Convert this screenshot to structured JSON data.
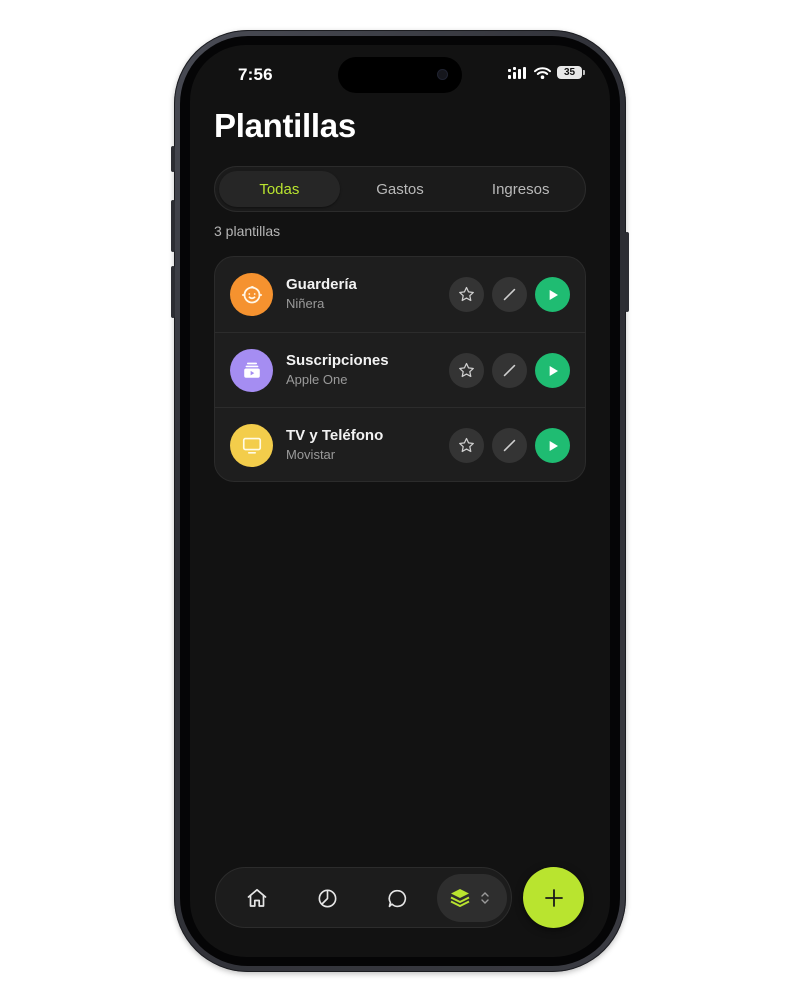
{
  "status_bar": {
    "time": "7:56",
    "battery": "35"
  },
  "page": {
    "title": "Plantillas",
    "count_label": "3 plantillas"
  },
  "filters": {
    "tabs": [
      {
        "label": "Todas",
        "active": true
      },
      {
        "label": "Gastos",
        "active": false
      },
      {
        "label": "Ingresos",
        "active": false
      }
    ]
  },
  "templates": [
    {
      "title": "Guardería",
      "subtitle": "Niñera",
      "icon": "baby-icon",
      "color": "#f5922f"
    },
    {
      "title": "Suscripciones",
      "subtitle": "Apple One",
      "icon": "subscription-icon",
      "color": "#a58df2"
    },
    {
      "title": "TV y Teléfono",
      "subtitle": "Movistar",
      "icon": "tv-icon",
      "color": "#f3cd4b"
    }
  ],
  "row_actions": [
    "star-icon",
    "pencil-icon",
    "play-icon"
  ],
  "nav": {
    "items": [
      "home-icon",
      "chart-icon",
      "chat-icon",
      "layers-icon"
    ],
    "active": "layers-icon"
  },
  "colors": {
    "accent": "#b9e42f",
    "play": "#1fbc72",
    "background": "#121212",
    "card": "#1e1e1e"
  }
}
